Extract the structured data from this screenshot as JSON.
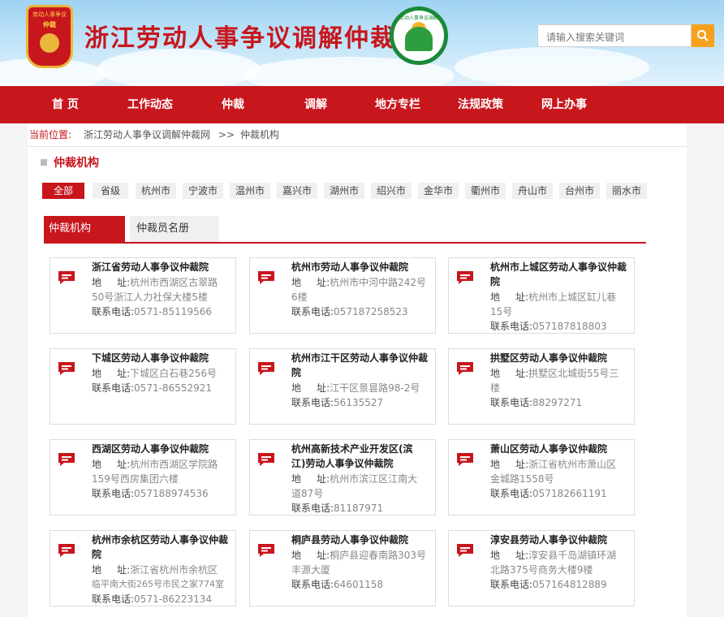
{
  "header": {
    "site_title": "浙江劳动人事争议调解仲裁网",
    "left_emblem_text": "劳动人事争议",
    "left_emblem_sub": "仲裁",
    "right_emblem_text": "劳动人事争议调解",
    "search_placeholder": "请输入搜索关键词"
  },
  "nav": [
    "首 页",
    "工作动态",
    "仲裁",
    "调解",
    "地方专栏",
    "法规政策",
    "网上办事"
  ],
  "breadcrumb": {
    "label": "当前位置:",
    "home": "浙江劳动人事争议调解仲裁网",
    "sep": ">>",
    "current": "仲裁机构"
  },
  "section_title": "仲裁机构",
  "cities": [
    "全部",
    "省级",
    "杭州市",
    "宁波市",
    "温州市",
    "嘉兴市",
    "湖州市",
    "绍兴市",
    "金华市",
    "衢州市",
    "舟山市",
    "台州市",
    "丽水市"
  ],
  "tabs": {
    "active": "仲裁机构",
    "inactive": "仲裁员名册"
  },
  "labels": {
    "addr_k1": "地",
    "addr_k2": "址:",
    "phone": "联系电话:"
  },
  "orgs": [
    {
      "name": "浙江省劳动人事争议仲裁院",
      "addr1": "杭州市西湖区古翠路",
      "addr2": "50号浙江人力社保大楼5楼",
      "phone": "0571-85119566"
    },
    {
      "name": "杭州市劳动人事争议仲裁院",
      "addr1": "杭州市中河中路242号",
      "addr2": "6楼",
      "phone": "057187258523"
    },
    {
      "name1": "杭州市上城区劳动人事争议仲裁",
      "name2": "院",
      "addr1": "杭州市上城区缸儿巷",
      "addr2": "15号",
      "phone": "057187818803"
    },
    {
      "name": "下城区劳动人事争议仲裁院",
      "addr1": "下城区白石巷256号",
      "phone": "0571-86552921"
    },
    {
      "name1": "杭州市江干区劳动人事争议仲裁",
      "name2": "院",
      "addr1": "江干区景昙路98-2号",
      "phone": "56135527"
    },
    {
      "name": "拱墅区劳动人事争议仲裁院",
      "addr1": "拱墅区北城街55号三",
      "addr2": "楼",
      "phone": "88297271"
    },
    {
      "name": "西湖区劳动人事争议仲裁院",
      "addr1": "杭州市西湖区学院路",
      "addr2": "159号西房集团六楼",
      "phone": "057188974536"
    },
    {
      "name1": "杭州高新技术产业开发区(滨",
      "name2": "江)劳动人事争议仲裁院",
      "addr1": "杭州市滨江区江南大",
      "addr2": "道87号",
      "phone": "81187971"
    },
    {
      "name": "萧山区劳动人事争议仲裁院",
      "addr1": "浙江省杭州市萧山区",
      "addr2": "金城路1558号",
      "phone": "057182661191"
    },
    {
      "name1": "杭州市余杭区劳动人事争议仲裁",
      "name2": "院",
      "addr1": "浙江省杭州市余杭区",
      "addr2": "临平南大街265号市民之家774室",
      "phone": "0571-86223134"
    },
    {
      "name": "桐庐县劳动人事争议仲裁院",
      "addr1": "桐庐县迎春南路303号",
      "addr2": "丰源大厦",
      "phone": "64601158"
    },
    {
      "name": "淳安县劳动人事争议仲裁院",
      "addr1": "淳安县千岛湖镇环湖",
      "addr2": "北路375号商务大楼9楼",
      "phone": "057164812889"
    }
  ],
  "colors": {
    "brand_red": "#c8161d",
    "search_orange": "#f5a11e",
    "emblem_green": "#1a8a3a"
  }
}
